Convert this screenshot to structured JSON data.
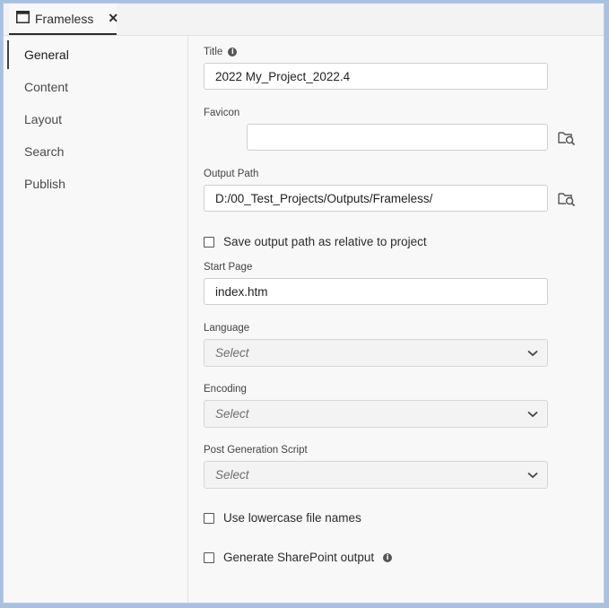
{
  "tab": {
    "label": "Frameless",
    "close_glyph": "✕",
    "icon": "window-icon"
  },
  "sidebar": {
    "items": [
      {
        "label": "General",
        "active": true
      },
      {
        "label": "Content",
        "active": false
      },
      {
        "label": "Layout",
        "active": false
      },
      {
        "label": "Search",
        "active": false
      },
      {
        "label": "Publish",
        "active": false
      }
    ]
  },
  "form": {
    "title": {
      "label": "Title",
      "value": "2022 My_Project_2022.4"
    },
    "favicon": {
      "label": "Favicon",
      "value": ""
    },
    "output_path": {
      "label": "Output Path",
      "value": "D:/00_Test_Projects/Outputs/Frameless/"
    },
    "save_relative": {
      "label": "Save output path as relative to project",
      "checked": false
    },
    "start_page": {
      "label": "Start Page",
      "value": "index.htm"
    },
    "language": {
      "label": "Language",
      "value": "Select"
    },
    "encoding": {
      "label": "Encoding",
      "value": "Select"
    },
    "post_script": {
      "label": "Post Generation Script",
      "value": "Select"
    },
    "lowercase": {
      "label": "Use lowercase file names",
      "checked": false
    },
    "sharepoint": {
      "label": "Generate SharePoint output",
      "checked": false
    }
  },
  "colors": {
    "accent_border": "#b9cbe6",
    "background": "#f8f8f8"
  }
}
